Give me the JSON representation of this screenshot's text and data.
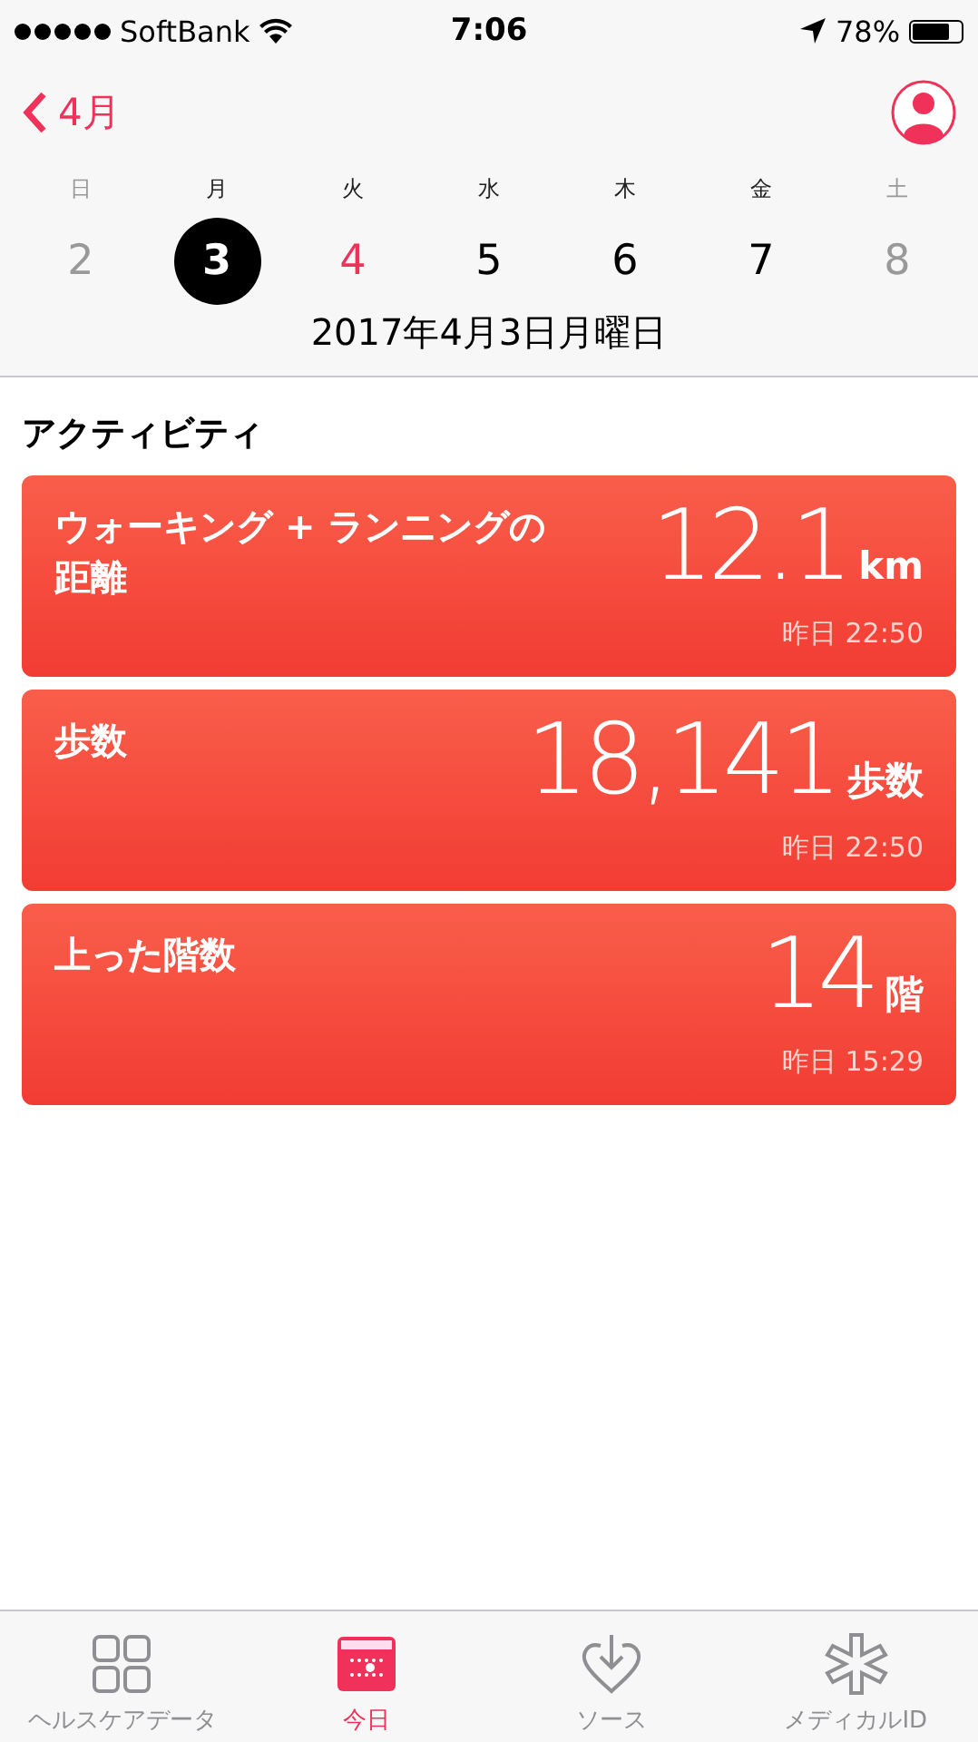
{
  "status_bar": {
    "carrier": "SoftBank",
    "time": "7:06",
    "battery": "78%"
  },
  "nav": {
    "back": "4月"
  },
  "week": [
    {
      "weekday": "日",
      "date": "2",
      "kind": "weekend",
      "selected": false
    },
    {
      "weekday": "月",
      "date": "3",
      "kind": "weekday",
      "selected": true
    },
    {
      "weekday": "火",
      "date": "4",
      "kind": "today",
      "selected": false
    },
    {
      "weekday": "水",
      "date": "5",
      "kind": "weekday",
      "selected": false
    },
    {
      "weekday": "木",
      "date": "6",
      "kind": "weekday",
      "selected": false
    },
    {
      "weekday": "金",
      "date": "7",
      "kind": "weekday",
      "selected": false
    },
    {
      "weekday": "土",
      "date": "8",
      "kind": "weekend",
      "selected": false
    }
  ],
  "selected_date": "2017年4月3日月曜日",
  "section_title": "アクティビティ",
  "cards": [
    {
      "title": "ウォーキング + ランニングの距離",
      "value": "12.1",
      "unit": "km",
      "time": "昨日 22:50"
    },
    {
      "title": "歩数",
      "value": "18,141",
      "unit": "歩数",
      "time": "昨日 22:50"
    },
    {
      "title": "上った階数",
      "value": "14",
      "unit": "階",
      "time": "昨日 15:29"
    }
  ],
  "tabs": [
    {
      "label": "ヘルスケアデータ",
      "kind": "grid",
      "selected": false
    },
    {
      "label": "今日",
      "kind": "calendar",
      "selected": true
    },
    {
      "label": "ソース",
      "kind": "heart",
      "selected": false
    },
    {
      "label": "メディカルID",
      "kind": "asterisk",
      "selected": false
    }
  ]
}
